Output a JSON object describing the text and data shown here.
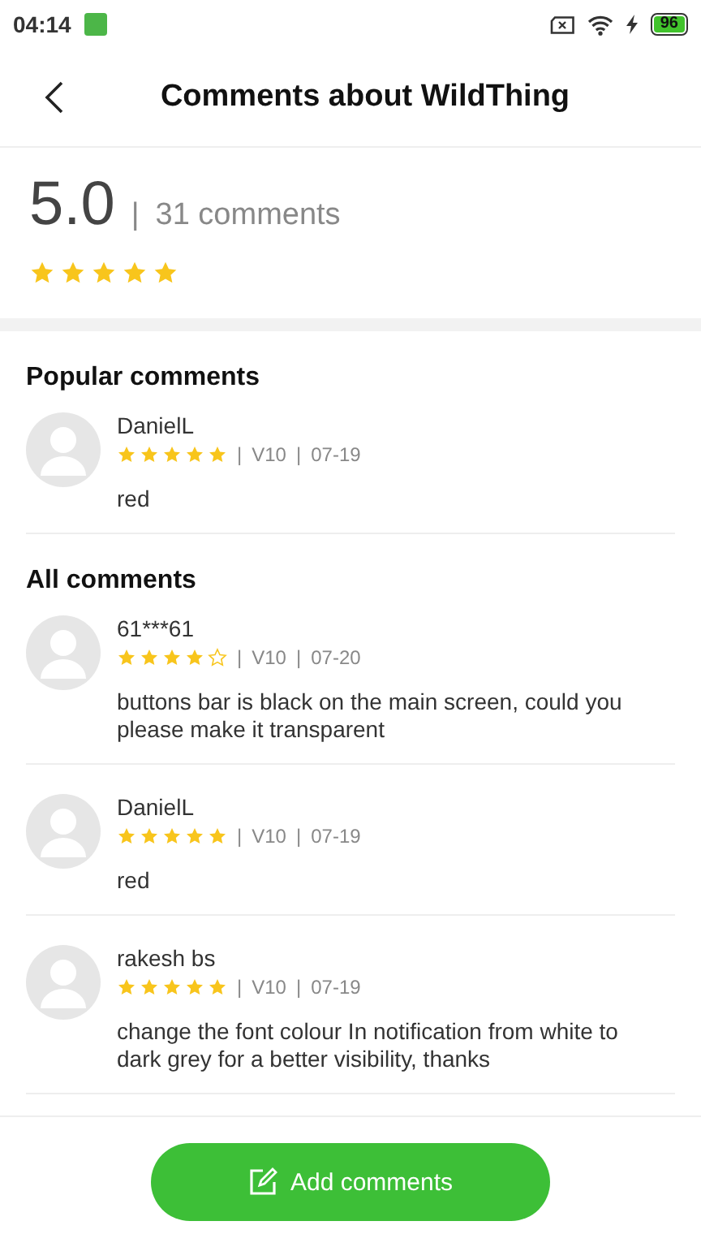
{
  "status_bar": {
    "time": "04:14",
    "battery": "96"
  },
  "header": {
    "title": "Comments about WildThing"
  },
  "summary": {
    "score": "5.0",
    "separator": "|",
    "count": "31 comments",
    "stars": 5
  },
  "sections": [
    {
      "title": "Popular comments",
      "comments": [
        {
          "author": "DanielL",
          "stars": 5,
          "separators": [
            "|",
            "|"
          ],
          "version": "V10",
          "date": "07-19",
          "text": "red"
        }
      ]
    },
    {
      "title": "All comments",
      "comments": [
        {
          "author": "61***61",
          "stars": 4,
          "separators": [
            "|",
            "|"
          ],
          "version": "V10",
          "date": "07-20",
          "text": "buttons bar is black on the main screen, could you please make it transparent"
        },
        {
          "author": "DanielL",
          "stars": 5,
          "separators": [
            "|",
            "|"
          ],
          "version": "V10",
          "date": "07-19",
          "text": "red"
        },
        {
          "author": "rakesh bs",
          "stars": 5,
          "separators": [
            "|",
            "|"
          ],
          "version": "V10",
          "date": "07-19",
          "text": "change the font colour In notification from white to dark grey for a better visibility, thanks"
        }
      ]
    }
  ],
  "add_button": {
    "label": "Add comments"
  }
}
